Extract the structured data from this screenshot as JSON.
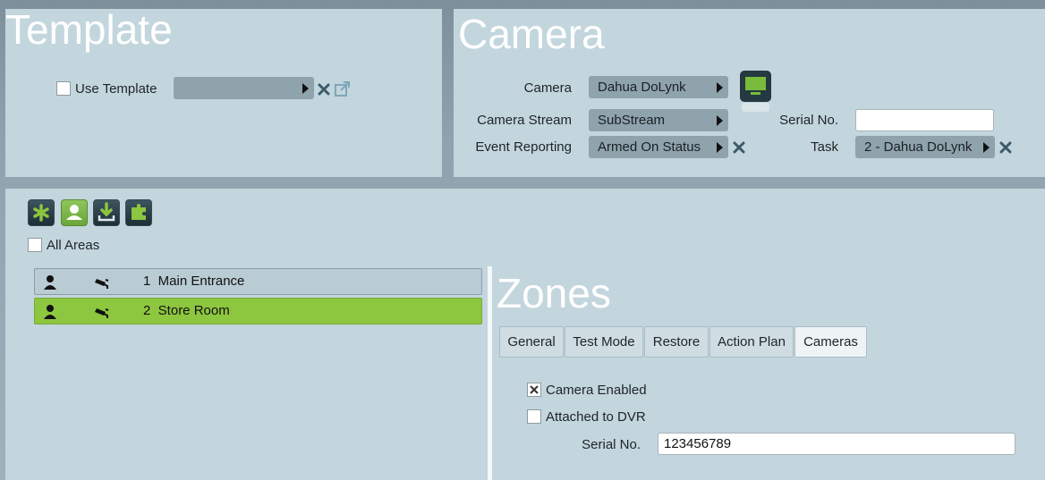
{
  "template_panel": {
    "title": "Template",
    "use_template_label": "Use Template",
    "use_template_checked": false,
    "template_value": ""
  },
  "camera_panel": {
    "title": "Camera",
    "camera_label": "Camera",
    "camera_value": "Dahua DoLynk",
    "stream_label": "Camera Stream",
    "stream_value": "SubStream",
    "event_label": "Event Reporting",
    "event_value": "Armed On Status",
    "serial_label": "Serial No.",
    "serial_value": "",
    "task_label": "Task",
    "task_value": "2 - Dahua DoLynk"
  },
  "toolbar": {
    "buttons": [
      "asterisk-icon",
      "person-icon",
      "download-icon",
      "puzzle-icon"
    ],
    "all_areas_label": "All Areas",
    "all_areas_checked": false
  },
  "areas": [
    {
      "number": "1",
      "name": "Main Entrance",
      "label": "1  Main Entrance",
      "selected": false
    },
    {
      "number": "2",
      "name": "Store Room",
      "label": "2  Store Room",
      "selected": true
    }
  ],
  "zones_panel": {
    "title": "Zones",
    "tabs": [
      "General",
      "Test Mode",
      "Restore",
      "Action Plan",
      "Cameras"
    ],
    "active_tab": "Cameras",
    "camera_enabled_label": "Camera Enabled",
    "camera_enabled_checked": true,
    "attached_dvr_label": "Attached to DVR",
    "attached_dvr_checked": false,
    "serial_label": "Serial No.",
    "serial_value": "123456789"
  },
  "colors": {
    "panel_bg": "#c3d6dd",
    "dropdown_bg": "#8fa3ad",
    "selected_row": "#8dc63f",
    "icon_x": "#3d5a6b"
  }
}
